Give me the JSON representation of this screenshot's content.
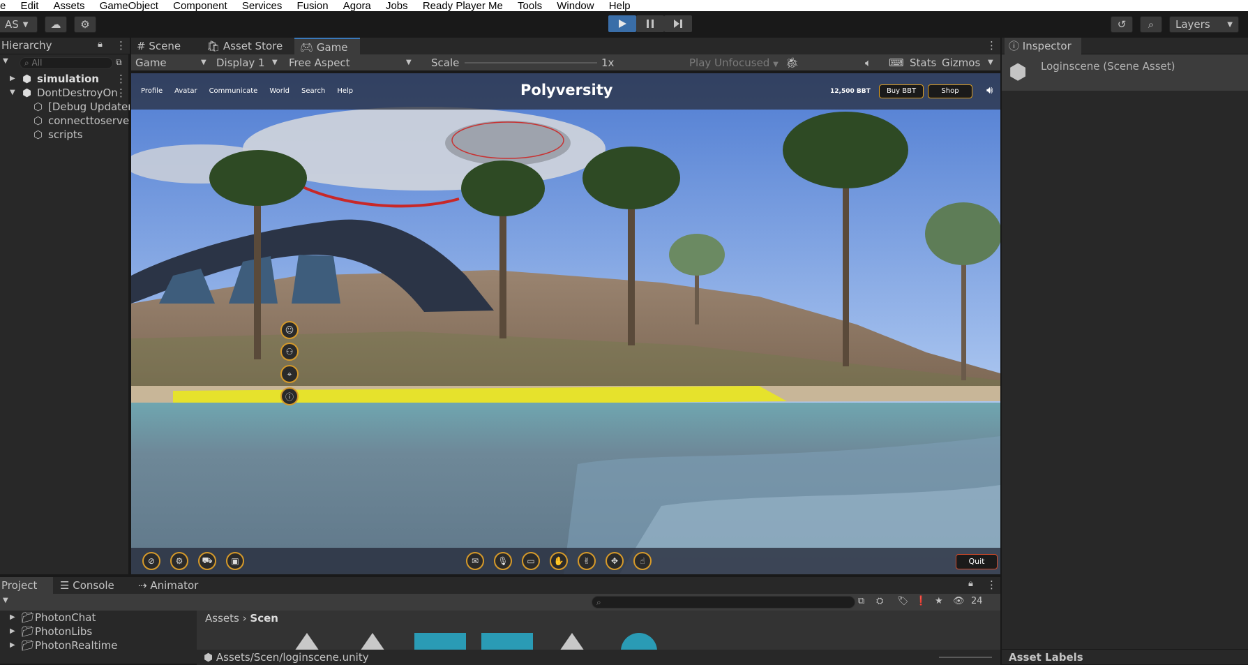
{
  "menu": [
    "e",
    "Edit",
    "Assets",
    "GameObject",
    "Component",
    "Services",
    "Fusion",
    "Agora",
    "Jobs",
    "Ready Player Me",
    "Tools",
    "Window",
    "Help"
  ],
  "toolbar": {
    "account": "AS",
    "layers": "Layers"
  },
  "hierarchy": {
    "title": "Hierarchy",
    "search_placeholder": "All",
    "items": [
      {
        "label": "simulation",
        "bold": true
      },
      {
        "label": "DontDestroyOn",
        "bold": false
      },
      {
        "label": "[Debug Updater",
        "bold": false
      },
      {
        "label": "connecttoserve",
        "bold": false
      },
      {
        "label": "scripts",
        "bold": false
      }
    ]
  },
  "tabs": {
    "scene": "Scene",
    "asset_store": "Asset Store",
    "game": "Game"
  },
  "game_controls": {
    "mode": "Game",
    "display": "Display 1",
    "aspect": "Free Aspect",
    "scale_label": "Scale",
    "scale_value": "1x",
    "play_focus": "Play Unfocused",
    "stats": "Stats",
    "gizmos": "Gizmos"
  },
  "game": {
    "nav": [
      "Profile",
      "Avatar",
      "Communicate",
      "World",
      "Search",
      "Help"
    ],
    "logo": "Polyversity",
    "balance": "12,500 BBT",
    "buy_button": "Buy BBT",
    "shop_button": "Shop",
    "quit_button": "Quit"
  },
  "inspector": {
    "title": "Inspector",
    "asset_name": "Loginscene (Scene Asset)",
    "asset_labels": "Asset Labels"
  },
  "bottom_tabs": {
    "project": "Project",
    "console": "Console",
    "animator": "Animator"
  },
  "project": {
    "folders": [
      "PhotonChat",
      "PhotonLibs",
      "PhotonRealtime"
    ],
    "breadcrumb_root": "Assets",
    "breadcrumb_current": "Scen",
    "path": "Assets/Scen/loginscene.unity",
    "hidden_count": "24"
  }
}
